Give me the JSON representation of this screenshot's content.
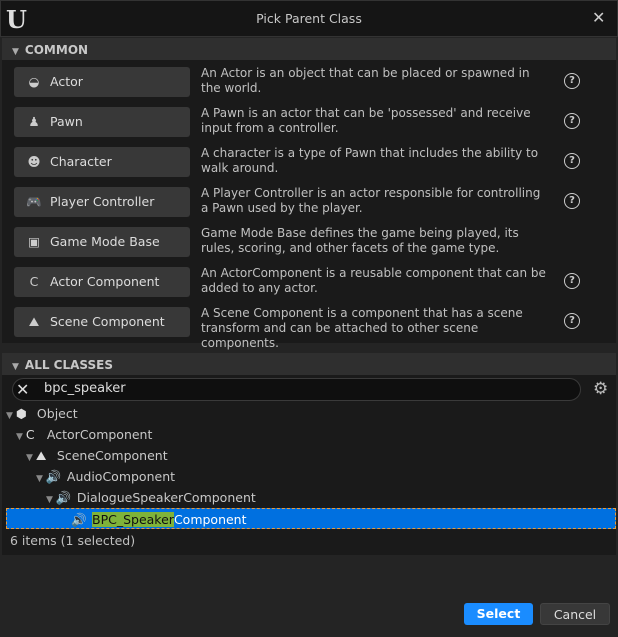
{
  "window": {
    "title": "Pick Parent Class",
    "logo": "U"
  },
  "common": {
    "header": "COMMON",
    "items": [
      {
        "label": "Actor",
        "icon": "actor-icon",
        "glyph": "◒",
        "desc": "An Actor is an object that can be placed or spawned in the world."
      },
      {
        "label": "Pawn",
        "icon": "pawn-icon",
        "glyph": "♟",
        "desc": "A Pawn is an actor that can be 'possessed' and receive input from a controller."
      },
      {
        "label": "Character",
        "icon": "character-icon",
        "glyph": "☻",
        "desc": "A character is a type of Pawn that includes the ability to walk around."
      },
      {
        "label": "Player Controller",
        "icon": "gamepad-icon",
        "glyph": "🎮",
        "desc": "A Player Controller is an actor responsible for controlling a Pawn used by the player."
      },
      {
        "label": "Game Mode Base",
        "icon": "game-mode-icon",
        "glyph": "▣",
        "desc": "Game Mode Base defines the game being played, its rules, scoring, and other facets of the game type."
      },
      {
        "label": "Actor Component",
        "icon": "actor-component-icon",
        "glyph": "C",
        "desc": "An ActorComponent is a reusable component that can be added to any actor."
      },
      {
        "label": "Scene Component",
        "icon": "scene-component-icon",
        "glyph": "⛰",
        "desc": "A Scene Component is a component that has a scene transform and can be attached to other scene components."
      }
    ]
  },
  "all_classes": {
    "header": "ALL CLASSES",
    "search_value": "bpc_speaker",
    "tree": [
      {
        "label": "Object",
        "glyph": "⬢",
        "icon": "object-icon"
      },
      {
        "label": "ActorComponent",
        "glyph": "C",
        "icon": "actor-component-icon"
      },
      {
        "label": "SceneComponent",
        "glyph": "⛰",
        "icon": "scene-component-icon"
      },
      {
        "label": "AudioComponent",
        "glyph": "🔊",
        "icon": "speaker-icon"
      },
      {
        "label": "DialogueSpeakerComponent",
        "glyph": "🔊",
        "icon": "speaker-icon"
      }
    ],
    "selected": {
      "match": "BPC_Speaker",
      "rest": "Component",
      "glyph": "🔊"
    },
    "status": "6 items (1 selected)"
  },
  "footer": {
    "select": "Select",
    "cancel": "Cancel"
  },
  "colors": {
    "accent": "#1a8cff",
    "selection": "#0070e0",
    "highlight": "#7fb33a"
  }
}
